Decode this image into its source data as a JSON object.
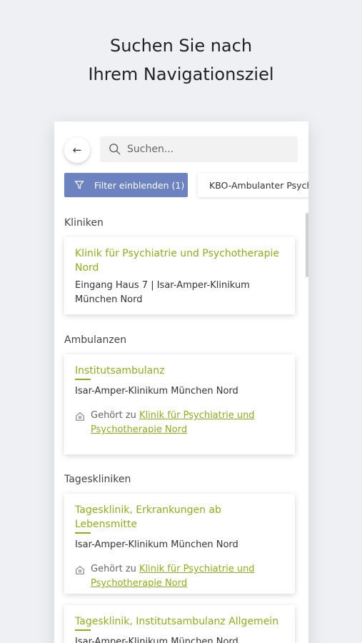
{
  "headline": {
    "line1": "Suchen Sie nach",
    "line2": "Ihrem Navigationsziel"
  },
  "toolbar": {
    "back_icon": "arrow-left-icon",
    "back_glyph": "←",
    "search_placeholder": "Suchen..."
  },
  "filters": {
    "filter_button_label": "Filter einblenden (1)",
    "active_chip_label": "KBO-Ambulanter Psychi"
  },
  "sections": {
    "kliniken": {
      "title": "Kliniken",
      "items": [
        {
          "name": "Klinik für Psychiatrie und Psychotherapie Nord",
          "location": "Eingang Haus 7 | Isar-Amper-Klinikum München Nord"
        }
      ]
    },
    "ambulanzen": {
      "title": "Ambulanzen",
      "items": [
        {
          "name": "Institutsambulanz",
          "location": "Isar-Amper-Klinikum München Nord",
          "belongs_prefix": "Gehört zu",
          "belongs_link": "Klinik für Psychiatrie und Psychotherapie Nord"
        }
      ]
    },
    "tageskliniken": {
      "title": "Tageskliniken",
      "items": [
        {
          "name": "Tagesklinik, Erkrankungen ab Lebensmitte",
          "location": "Isar-Amper-Klinikum München Nord",
          "belongs_prefix": "Gehört zu",
          "belongs_link": "Klinik für Psychiatrie und Psychotherapie Nord"
        },
        {
          "name": "Tagesklinik, Institutsambulanz Allgemein",
          "location": "Isar-Amper-Klinikum München Nord"
        }
      ]
    }
  },
  "colors": {
    "accent_green": "#8dae1e",
    "filter_blue": "#6d82c0",
    "background": "#eef0f4"
  }
}
